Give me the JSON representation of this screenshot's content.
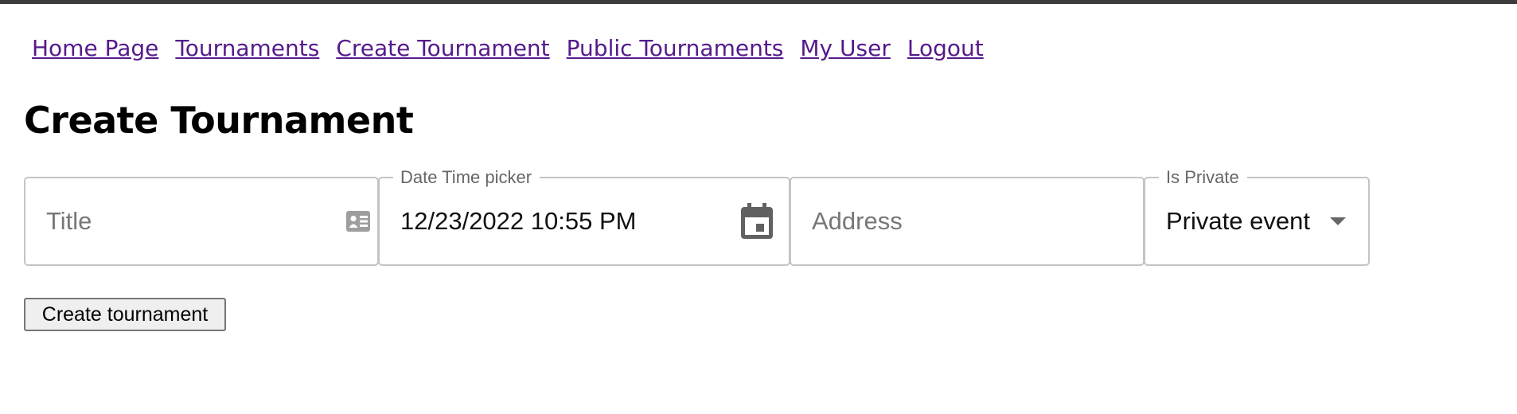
{
  "nav": {
    "items": [
      {
        "label": "Home Page"
      },
      {
        "label": "Tournaments"
      },
      {
        "label": "Create Tournament"
      },
      {
        "label": "Public Tournaments"
      },
      {
        "label": "My User"
      },
      {
        "label": "Logout"
      }
    ],
    "link_color": "#551a8b"
  },
  "page": {
    "title": "Create Tournament"
  },
  "form": {
    "title_field": {
      "placeholder": "Title",
      "icon": "id-card-icon"
    },
    "datetime_field": {
      "legend": "Date Time picker",
      "value": "12/23/2022 10:55 PM",
      "icon": "calendar-icon"
    },
    "address_field": {
      "placeholder": "Address"
    },
    "privacy_field": {
      "legend": "Is Private",
      "value": "Private event",
      "icon": "dropdown-arrow-icon"
    },
    "submit_label": "Create tournament"
  }
}
